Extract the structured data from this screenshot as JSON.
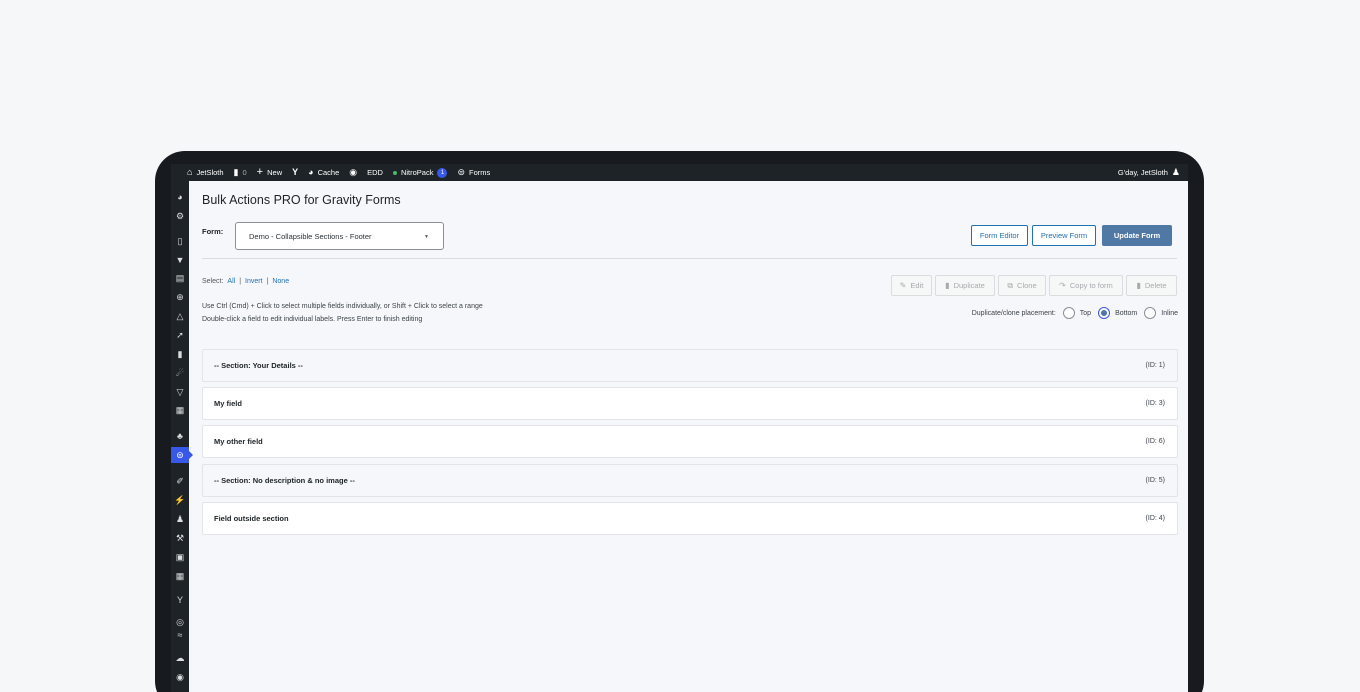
{
  "adminbar": {
    "site_name": "JetSloth",
    "comments_count": "0",
    "new_label": "New",
    "cache_label": "Cache",
    "edd_label": "EDD",
    "nitropack_label": "NitroPack",
    "nitropack_count": "1",
    "forms_label": "Forms",
    "greeting": "G'day, JetSloth"
  },
  "sidebar": {
    "icons": [
      "dashboard-icon",
      "gear-icon",
      "pages-icon",
      "cart-icon",
      "basket-icon",
      "lifebuoy-icon",
      "flask-icon",
      "pin-icon",
      "comment-icon",
      "network-icon",
      "funnel-icon",
      "grid-icon",
      "translate-icon",
      "gravity-forms-icon",
      "brush-icon",
      "plugin-icon",
      "users-icon",
      "wrench-icon",
      "settings-icon",
      "table-icon",
      "yoast-icon",
      "fingerprint-icon",
      "wave-icon",
      "cloud-icon",
      "wordpress-icon"
    ],
    "active": "gravity-forms-icon"
  },
  "page": {
    "title": "Bulk Actions PRO for Gravity Forms",
    "form_label": "Form:",
    "form_selected": "Demo - Collapsible Sections - Footer",
    "form_editor_label": "Form Editor",
    "preview_form_label": "Preview Form",
    "update_form_label": "Update Form"
  },
  "selection": {
    "prefix": "Select:",
    "all": "All",
    "invert": "Invert",
    "none": "None"
  },
  "toolbar": {
    "edit": "Edit",
    "duplicate": "Duplicate",
    "clone": "Clone",
    "copy_to_form": "Copy to form",
    "delete": "Delete"
  },
  "hints": {
    "line1": "Use Ctrl (Cmd) + Click to select multiple fields individually, or Shift + Click to select a range",
    "line2": "Double-click a field to edit individual labels. Press Enter to finish editing"
  },
  "placement": {
    "label": "Duplicate/clone placement:",
    "options": [
      "Top",
      "Bottom",
      "Inline"
    ],
    "selected": "Bottom"
  },
  "fields": [
    {
      "label": "-- Section: Your Details --",
      "id": "(ID: 1)",
      "type": "section"
    },
    {
      "label": "My field",
      "id": "(ID: 3)",
      "type": "field"
    },
    {
      "label": "My other field",
      "id": "(ID: 6)",
      "type": "field"
    },
    {
      "label": "-- Section: No description & no image --",
      "id": "(ID: 5)",
      "type": "section"
    },
    {
      "label": "Field outside section",
      "id": "(ID: 4)",
      "type": "field"
    }
  ],
  "colors": {
    "adminbar_bg": "#1d2327",
    "accent_blue": "#2271b1",
    "primary_button": "#4f78a4",
    "active_menu": "#3858e9",
    "status_green": "#4ab866"
  }
}
